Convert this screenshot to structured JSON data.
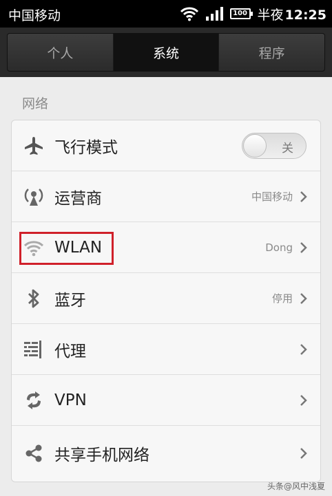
{
  "status_bar": {
    "carrier": "中国移动",
    "battery": "100",
    "time_period": "半夜",
    "time": "12:25"
  },
  "tabs": [
    {
      "label": "个人",
      "active": false
    },
    {
      "label": "系统",
      "active": true
    },
    {
      "label": "程序",
      "active": false
    }
  ],
  "section": {
    "title": "网络"
  },
  "rows": {
    "airplane": {
      "label": "飞行模式",
      "toggle_text": "关",
      "icon": "airplane-icon"
    },
    "carrier": {
      "label": "运营商",
      "value": "中国移动",
      "icon": "cell-tower-icon"
    },
    "wlan": {
      "label": "WLAN",
      "value": "Dong",
      "icon": "wifi-icon"
    },
    "bluetooth": {
      "label": "蓝牙",
      "value": "停用",
      "icon": "bluetooth-icon"
    },
    "proxy": {
      "label": "代理",
      "icon": "proxy-icon"
    },
    "vpn": {
      "label": "VPN",
      "icon": "vpn-icon"
    },
    "tethering": {
      "label": "共享手机网络",
      "icon": "share-icon"
    }
  },
  "watermark": "头条@风中浅夏",
  "colors": {
    "highlight": "#d0202a",
    "status_bar": "#000000",
    "tab_bar": "#2a2a2a"
  }
}
